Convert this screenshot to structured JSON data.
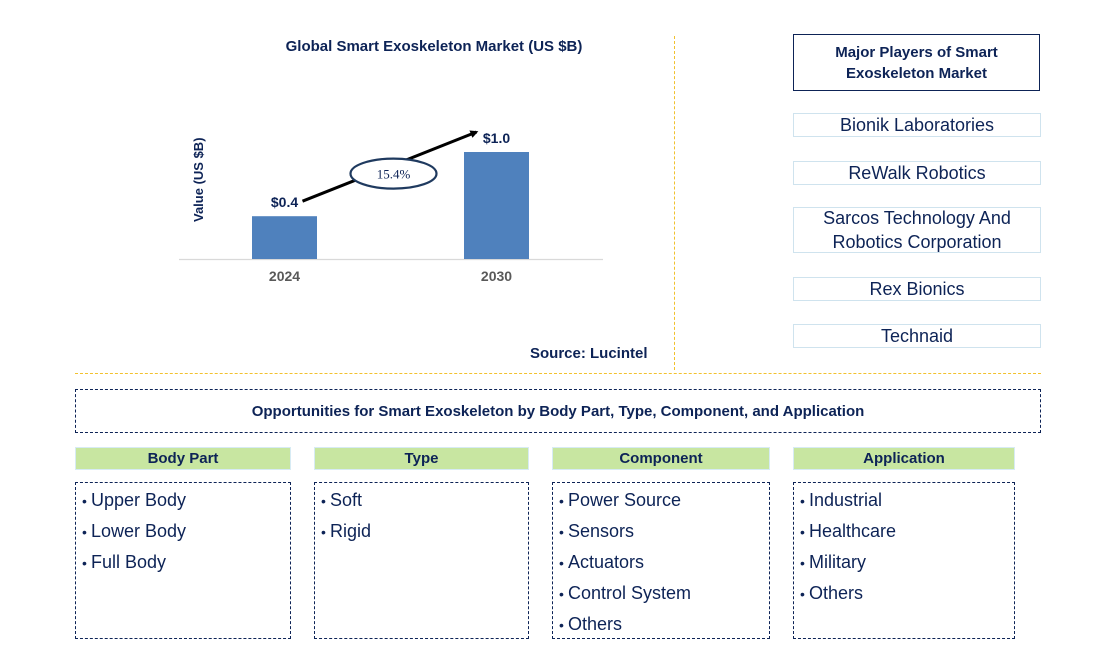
{
  "chart_data": {
    "type": "bar",
    "title": "Global Smart Exoskeleton Market (US $B)",
    "xlabel": "",
    "ylabel": "Value (US $B)",
    "categories": [
      "2024",
      "2030"
    ],
    "values": [
      0.4,
      1.0
    ],
    "data_labels": [
      "$0.4",
      "$1.0"
    ],
    "ylim": [
      0,
      1.0
    ],
    "grid": false,
    "bar_color": "#4f81bd",
    "annotation": {
      "text": "15.4%",
      "meaning": "CAGR 2024-2030",
      "shape": "ellipse-on-arrow"
    }
  },
  "source": "Source: Lucintel",
  "players": {
    "title": "Major Players of Smart Exoskeleton Market",
    "items": [
      "Bionik Laboratories",
      "ReWalk Robotics",
      "Sarcos Technology And Robotics Corporation",
      "Rex Bionics",
      "Technaid"
    ]
  },
  "opportunities": {
    "title": "Opportunities for Smart Exoskeleton by Body Part, Type, Component, and Application",
    "categories": [
      {
        "label": "Body Part",
        "items": [
          "Upper Body",
          "Lower Body",
          "Full Body"
        ]
      },
      {
        "label": "Type",
        "items": [
          "Soft",
          "Rigid"
        ]
      },
      {
        "label": "Component",
        "items": [
          "Power Source",
          "Sensors",
          "Actuators",
          "Control System",
          "Others"
        ]
      },
      {
        "label": "Application",
        "items": [
          "Industrial",
          "Healthcare",
          "Military",
          "Others"
        ]
      }
    ]
  },
  "colors": {
    "text_navy": "#0d2356",
    "bar_blue": "#4f81bd",
    "header_green": "#c8e6a1",
    "divider_gold": "#f2c12e"
  }
}
